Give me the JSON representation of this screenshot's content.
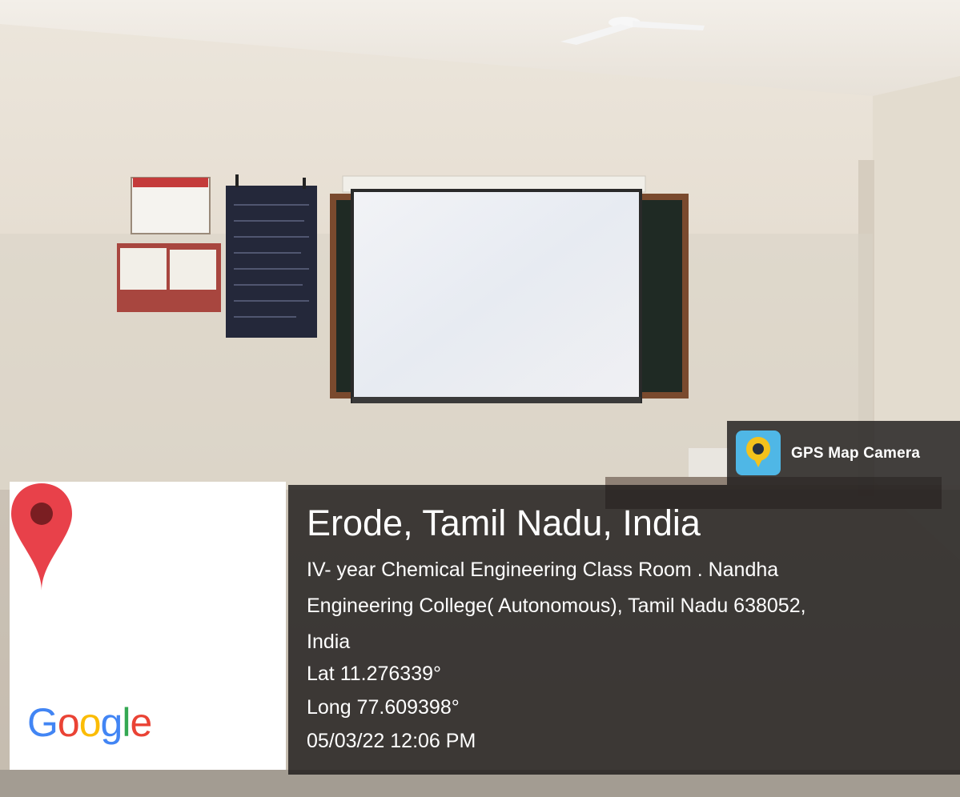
{
  "overlay": {
    "app_name": "GPS Map Camera",
    "app_icon": "gps-map-camera-icon",
    "location_title": "Erode, Tamil Nadu, India",
    "address_line_1": "IV- year Chemical Engineering Class Room . Nandha",
    "address_line_2": "Engineering College( Autonomous), Tamil Nadu 638052,",
    "address_line_3": "India",
    "latitude": "Lat 11.276339°",
    "longitude": "Long 77.609398°",
    "datetime": "05/03/22 12:06 PM"
  },
  "map_card": {
    "pin_icon": "map-pin-icon",
    "brand_letters": [
      "G",
      "o",
      "o",
      "g",
      "l",
      "e"
    ],
    "brand_colors": [
      "#4285F4",
      "#EA4335",
      "#FBBC05",
      "#4285F4",
      "#34A853",
      "#EA4335"
    ]
  },
  "colors": {
    "pin": "#e8414a",
    "overlay_bg": "#1f1c1c",
    "gps_logo_bg": "#4fb7e6"
  }
}
